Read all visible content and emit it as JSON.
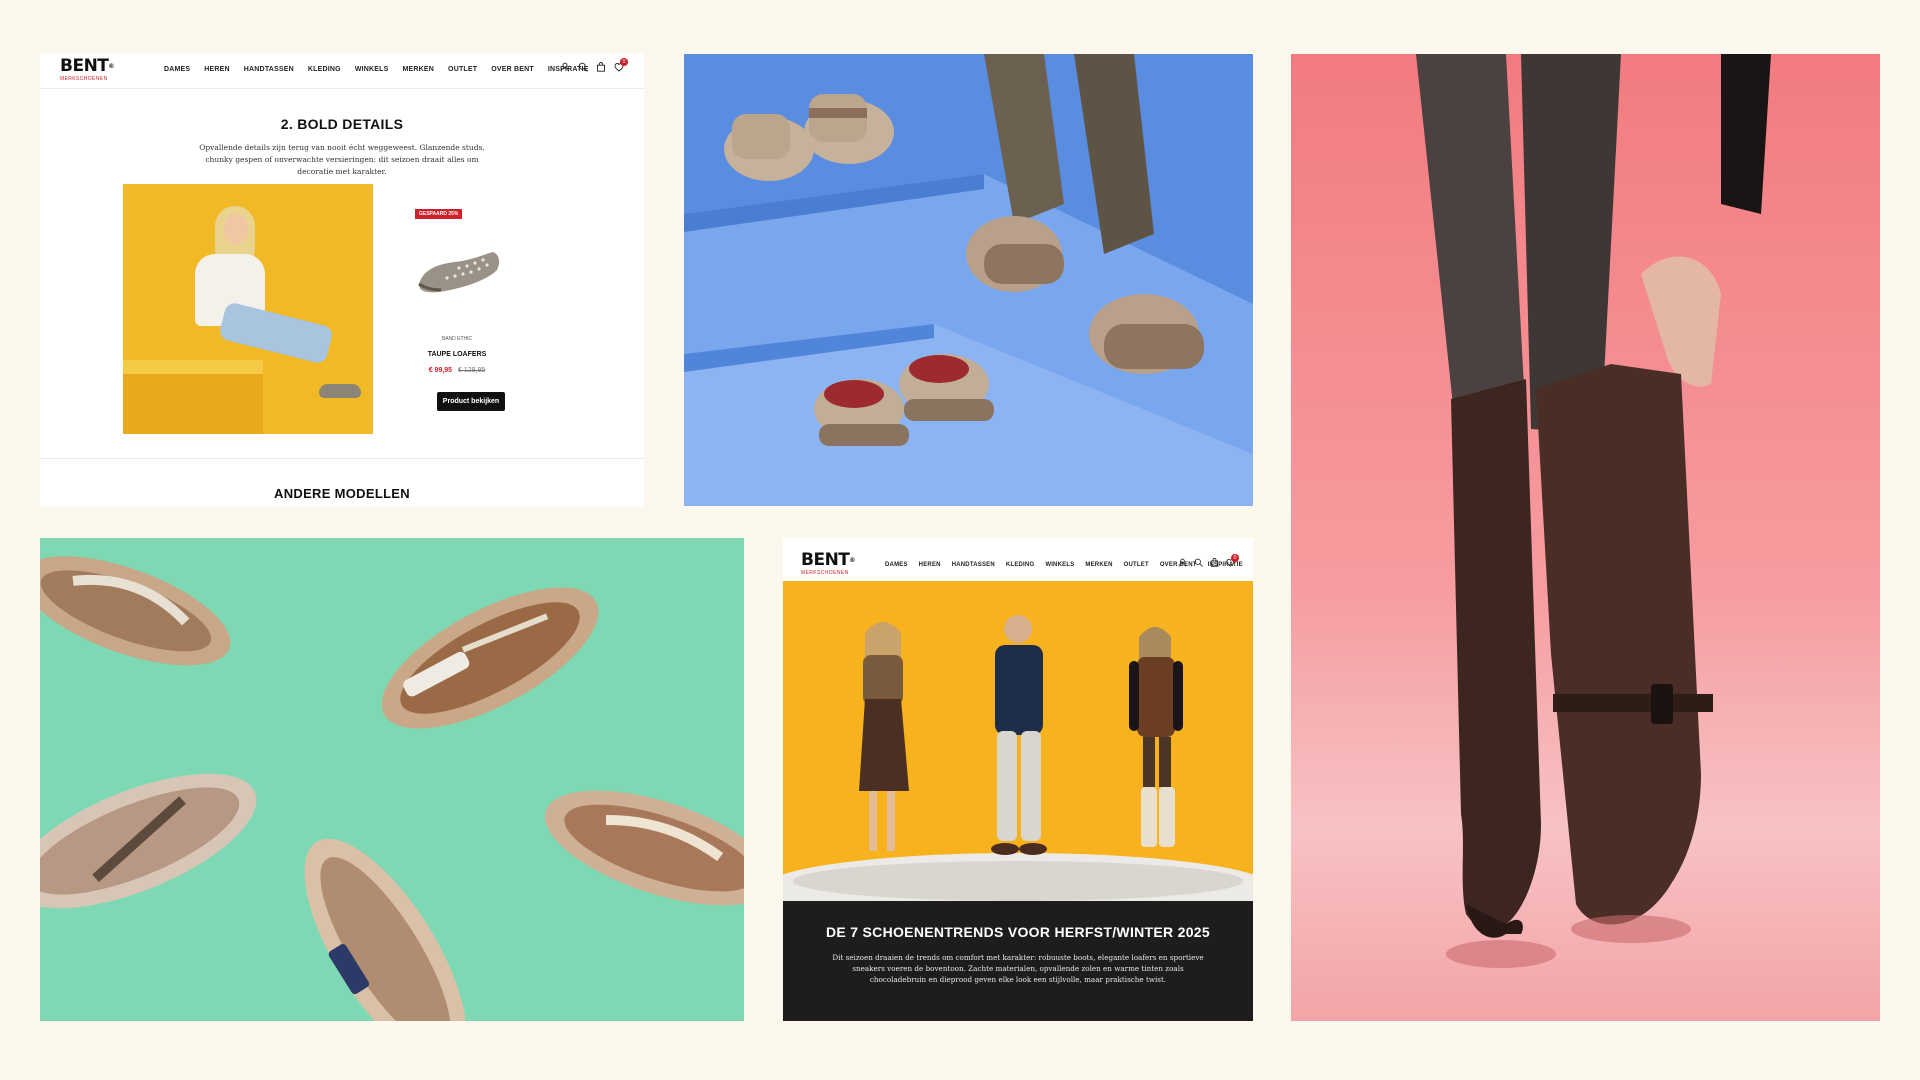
{
  "nav": {
    "logo_text": "BENT",
    "logo_sub": "MERKSCHOENEN",
    "items": [
      "DAMES",
      "HEREN",
      "HANDTASSEN",
      "KLEDING",
      "WINKELS",
      "MERKEN",
      "OUTLET",
      "OVER BENT",
      "INSPIRATIE"
    ],
    "cart_count": "0"
  },
  "panel_a": {
    "section_title": "2. BOLD DETAILS",
    "description": "Opvallende details zijn terug van nooit écht weggeweest. Glanzende studs, chunky gespen of onverwachte versieringen: dit seizoen draait alles om decoratie met karakter.",
    "badge": "GESPAARD 25%",
    "product": {
      "brand": "BAND ETHIC",
      "name": "TAUPE LOAFERS",
      "price_new": "€ 99,95",
      "price_old": "€ 129,95",
      "button": "Product bekijken"
    },
    "other_heading": "ANDERE MODELLEN"
  },
  "panel_e": {
    "headline": "DE 7 SCHOENENTRENDS VOOR HERFST/WINTER 2025",
    "body": "Dit seizoen draaien de trends om comfort met karakter: robuuste boots, elegante loafers en sportieve sneakers voeren de boventoon. Zachte materialen, opvallende zolen en warme tinten zoals chocoladebruin en dieprood geven elke look een stijlvolle, maar praktische twist."
  },
  "colors": {
    "background": "#fcf8ee",
    "accent_red": "#d0202a",
    "hero_yellow": "#f7b21e",
    "blue_steps": "#5b8ee0",
    "mint": "#7fd8b4",
    "pink": "#f27b7f"
  },
  "icons": [
    "user-icon",
    "search-icon",
    "bag-icon",
    "cart-icon"
  ]
}
